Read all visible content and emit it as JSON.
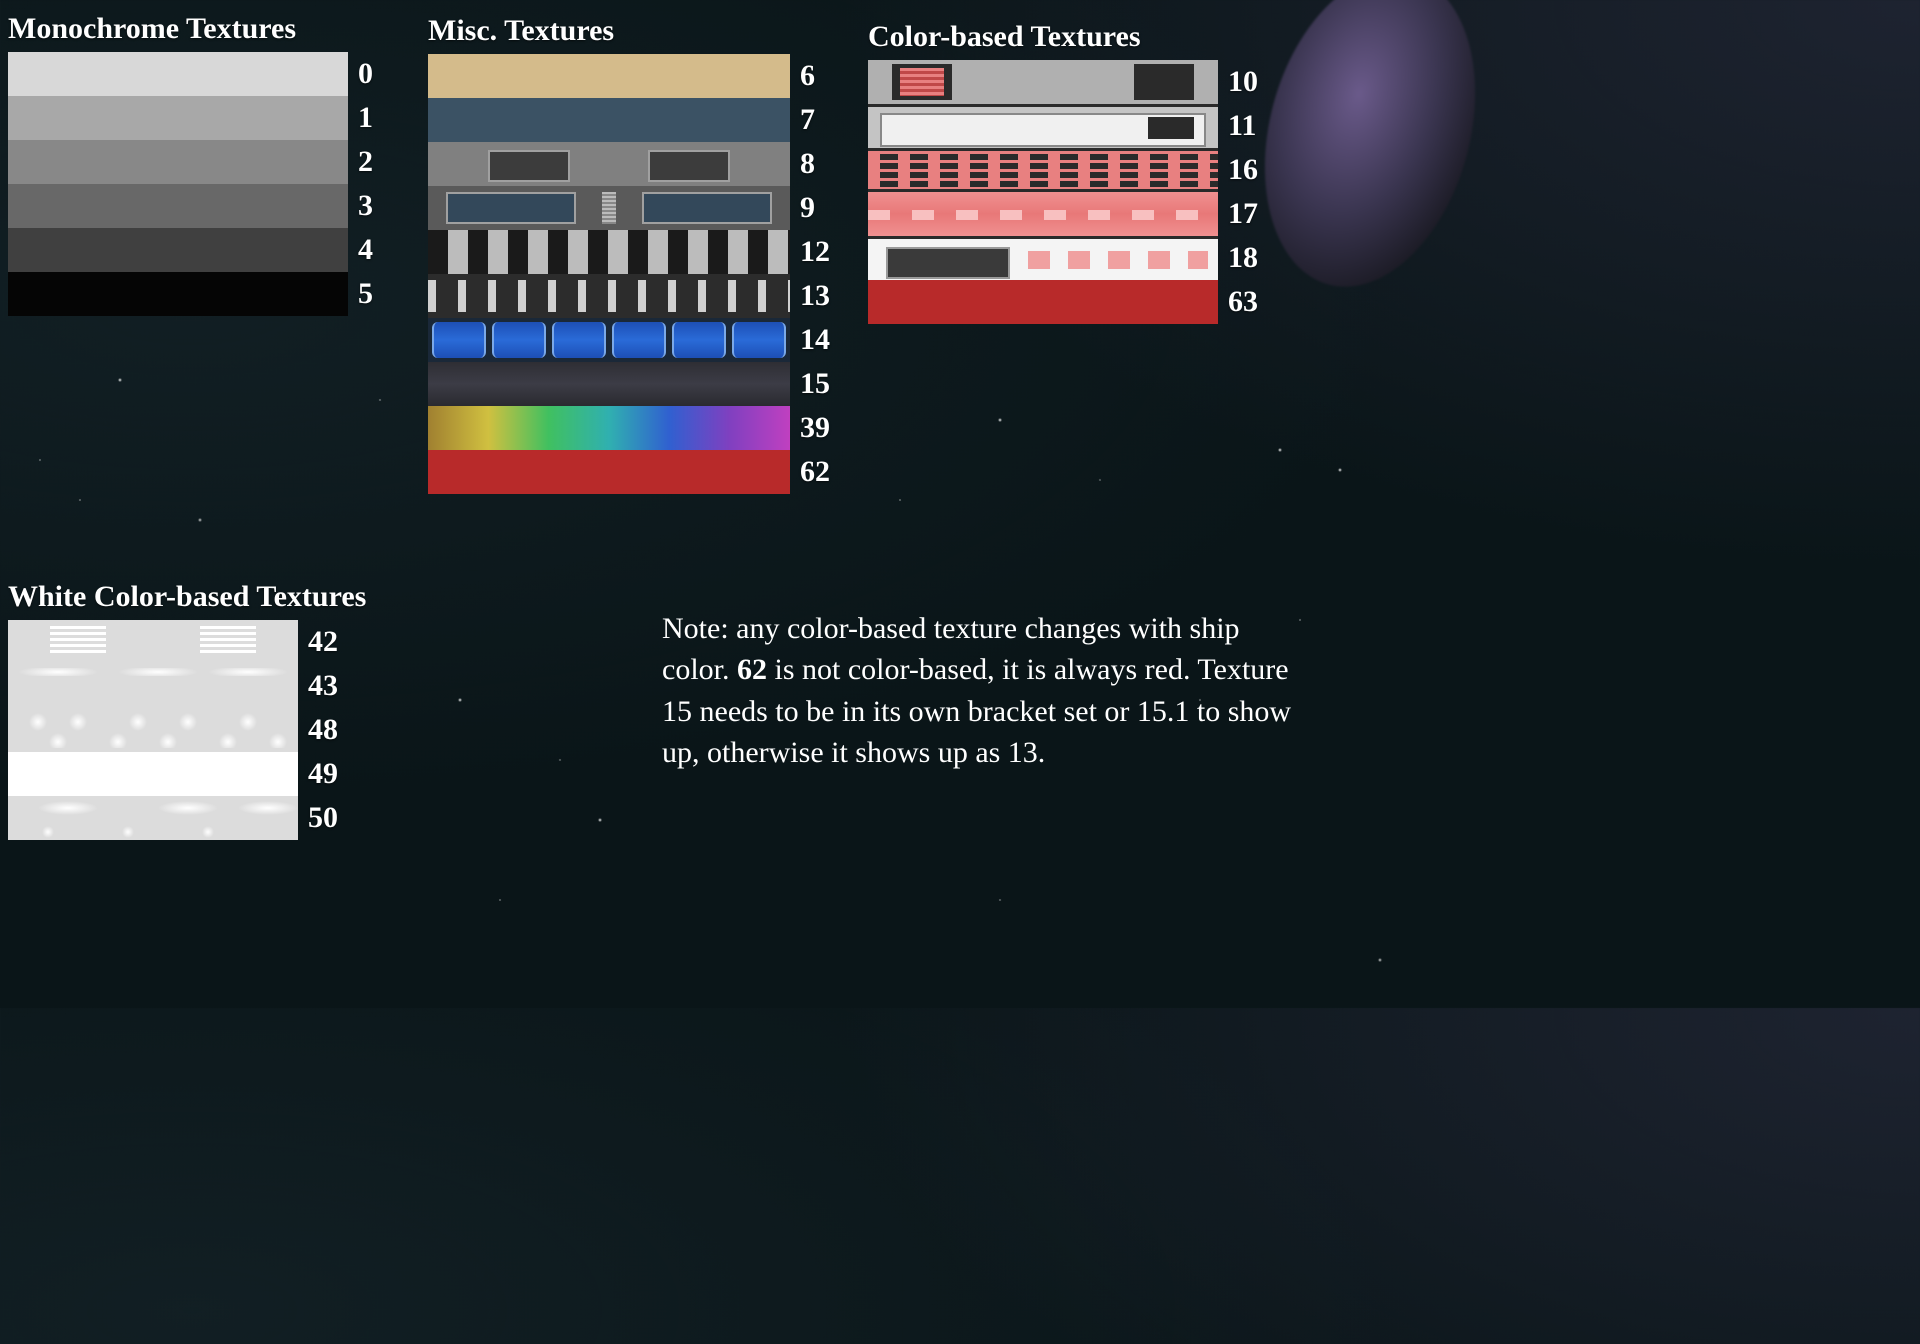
{
  "sections": {
    "mono": {
      "title": "Monochrome Textures",
      "items": [
        "0",
        "1",
        "2",
        "3",
        "4",
        "5"
      ]
    },
    "misc": {
      "title": "Misc. Textures",
      "items": [
        "6",
        "7",
        "8",
        "9",
        "12",
        "13",
        "14",
        "15",
        "39",
        "62"
      ]
    },
    "color": {
      "title": "Color-based Textures",
      "items": [
        "10",
        "11",
        "16",
        "17",
        "18",
        "63"
      ]
    },
    "white": {
      "title": "White Color-based Textures",
      "items": [
        "42",
        "43",
        "48",
        "49",
        "50"
      ]
    }
  },
  "note": {
    "lead": "Note: any color-based texture changes with ship color. ",
    "bold1": "62",
    "mid1": " is not color-based, it is always red. Texture 15 needs to be in its own bracket set or 15.1 to show up, otherwise it shows up as 13."
  }
}
